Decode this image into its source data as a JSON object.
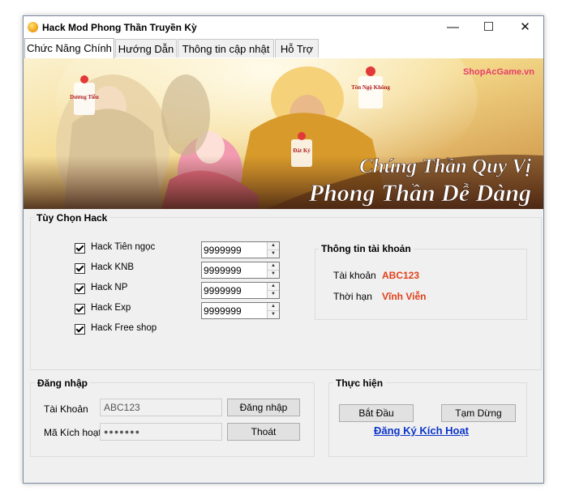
{
  "window": {
    "title": "Hack Mod Phong Thần Truyền Kỳ"
  },
  "window_controls": {
    "minimize": "—",
    "maximize": "☐",
    "close": "✕"
  },
  "tabs": [
    {
      "label": "Chức Năng Chính"
    },
    {
      "label": "Hướng Dẫn"
    },
    {
      "label": "Thông tin cập nhật"
    },
    {
      "label": "Hỗ Trợ"
    }
  ],
  "banner": {
    "watermark": "ShopAcGame.vn",
    "line1": "Chúng Thần Quy Vị",
    "line2": "Phong Thần Dễ Dàng",
    "badges": [
      "Tôn Ngộ Không",
      "Đát Kỷ",
      "Dương Tiễn"
    ]
  },
  "hack_options": {
    "title": "Tùy Chọn Hack",
    "items": [
      {
        "label": "Hack Tiên ngọc",
        "checked": true,
        "value": "9999999"
      },
      {
        "label": "Hack KNB",
        "checked": true,
        "value": "9999999"
      },
      {
        "label": "Hack NP",
        "checked": true,
        "value": "9999999"
      },
      {
        "label": "Hack Exp",
        "checked": true,
        "value": "9999999"
      },
      {
        "label": "Hack Free shop",
        "checked": true
      }
    ]
  },
  "account_info": {
    "title": "Thông tin tài khoản",
    "account_label": "Tài khoản",
    "account_value": "ABC123",
    "expiry_label": "Thời hạn",
    "expiry_value": "Vĩnh Viễn"
  },
  "login": {
    "title": "Đăng nhập",
    "account_label": "Tài Khoản",
    "account_value": "ABC123",
    "code_label": "Mã Kích hoạt",
    "code_value": "●●●●●●●",
    "login_button": "Đăng nhập",
    "exit_button": "Thoát"
  },
  "execute": {
    "title": "Thực hiện",
    "start_button": "Bắt Đầu",
    "pause_button": "Tạm Dừng",
    "register_link": "Đăng Ký Kích Hoạt"
  },
  "colors": {
    "accent": "#e0401a",
    "link": "#0b35c9"
  }
}
